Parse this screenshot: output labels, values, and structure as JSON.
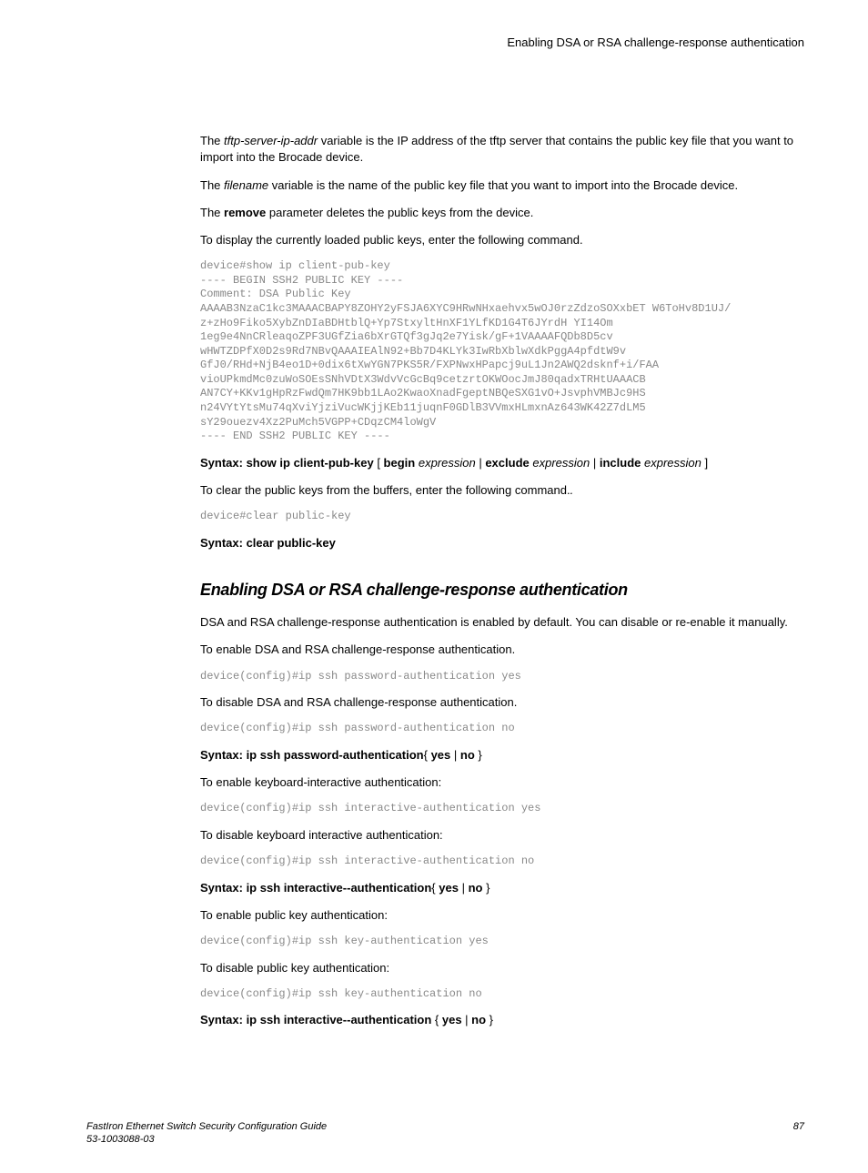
{
  "header": {
    "title": "Enabling DSA or RSA challenge-response authentication"
  },
  "paragraphs": {
    "p1_pre": "The ",
    "p1_var": "tftp-server-ip-addr",
    "p1_post": " variable is the IP address of the tftp server that contains the public key file that you want to import into the Brocade device.",
    "p2_pre": "The ",
    "p2_var": "filename",
    "p2_post": " variable is the name of the public key file that you want to import into the Brocade device.",
    "p3_pre": "The ",
    "p3_bold": "remove",
    "p3_post": " parameter deletes the public keys from the device.",
    "p4": "To display the currently loaded public keys, enter the following command.",
    "p5": "To clear the public keys from the buffers, enter the following command.",
    "p6": "DSA and RSA challenge-response authentication is enabled by default. You can disable or re-enable it manually.",
    "p7": "To enable DSA and RSA challenge-response authentication.",
    "p8": "To disable DSA and RSA challenge-response authentication.",
    "p9": "To enable keyboard-interactive authentication:",
    "p10": "To disable keyboard interactive authentication:",
    "p11": "To enable public key authentication:",
    "p12": "To disable public key authentication:"
  },
  "code": {
    "block1": "device#show ip client-pub-key\n---- BEGIN SSH2 PUBLIC KEY ----\nComment: DSA Public Key\nAAAAB3NzaC1kc3MAAACBAPY8ZOHY2yFSJA6XYC9HRwNHxaehvx5wOJ0rzZdzoSOXxbET W6ToHv8D1UJ/\nz+zHo9Fiko5XybZnDIaBDHtblQ+Yp7StxyltHnXF1YLfKD1G4T6JYrdH YI14Om\n1eg9e4NnCRleaqoZPF3UGfZia6bXrGTQf3gJq2e7Yisk/gF+1VAAAAFQDb8D5cv\nwHWTZDPfX0D2s9Rd7NBvQAAAIEAlN92+Bb7D4KLYk3IwRbXblwXdkPggA4pfdtW9v\nGfJ0/RHd+NjB4eo1D+0dix6tXwYGN7PKS5R/FXPNwxHPapcj9uL1Jn2AWQ2dsknf+i/FAA\nvioUPkmdMc0zuWoSOEsSNhVDtX3WdvVcGcBq9cetzrtOKWOocJmJ80qadxTRHtUAAACB\nAN7CY+KKv1gHpRzFwdQm7HK9bb1LAo2KwaoXnadFgeptNBQeSXG1vO+JsvphVMBJc9HS\nn24VYtYtsMu74qXviYjziVucWKjjKEb11juqnF0GDlB3VVmxHLmxnAz643WK42Z7dLM5\nsY29ouezv4Xz2PuMch5VGPP+CDqzCM4loWgV\n---- END SSH2 PUBLIC KEY ----",
    "block2": "device#clear public-key",
    "block3": "device(config)#ip ssh password-authentication yes",
    "block4": "device(config)#ip ssh password-authentication no",
    "block5": "device(config)#ip ssh interactive-authentication yes",
    "block6": "device(config)#ip ssh interactive-authentication no",
    "block7": "device(config)#ip ssh key-authentication yes",
    "block8": "device(config)#ip ssh key-authentication no"
  },
  "syntax": {
    "s1_lead": "Syntax: show ip client-pub-key",
    "s1_b1": " [ ",
    "s1_bold1": "begin",
    "s1_sp1": " ",
    "s1_it1": "expression",
    "s1_sep1": " | ",
    "s1_bold2": "exclude",
    "s1_sp2": " ",
    "s1_it2": "expression",
    "s1_sep2": " | ",
    "s1_bold3": "include",
    "s1_sp3": " ",
    "s1_it3": "expression",
    "s1_end": " ]",
    "s2": "Syntax: clear public-key",
    "s3_lead": "Syntax: ip ssh password-authentication",
    "s3_b1": "{ ",
    "s3_yes": "yes",
    "s3_sep": " | ",
    "s3_no": "no",
    "s3_end": " }",
    "s4_lead": "Syntax: ip ssh interactive--authentication",
    "s5_lead": "Syntax: ip ssh interactive--authentication "
  },
  "heading": {
    "h1": "Enabling DSA or RSA challenge-response authentication"
  },
  "footer": {
    "doc_title": "FastIron Ethernet Switch Security Configuration Guide",
    "doc_num": "53-1003088-03",
    "page": "87"
  }
}
